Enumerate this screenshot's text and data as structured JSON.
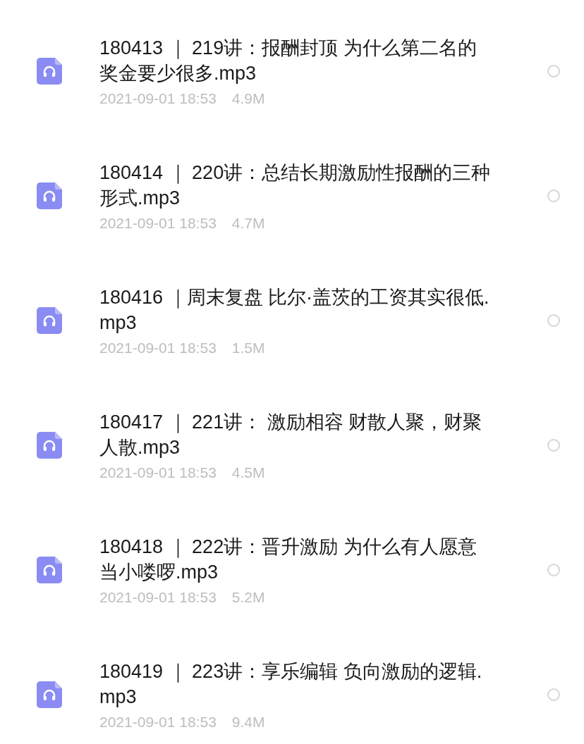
{
  "files": [
    {
      "name": "180413 ｜ 219讲：报酬封顶  为什么第二名的奖金要少很多.mp3",
      "date": "2021-09-01 18:53",
      "size": "4.9M",
      "selected": false
    },
    {
      "name": "180414 ｜ 220讲：总结长期激励性报酬的三种形式.mp3",
      "date": "2021-09-01 18:53",
      "size": "4.7M",
      "selected": false
    },
    {
      "name": "180416 ｜周末复盘  比尔·盖茨的工资其实很低.mp3",
      "date": "2021-09-01 18:53",
      "size": "1.5M",
      "selected": false
    },
    {
      "name": "180417 ｜ 221讲：  激励相容  财散人聚，财聚人散.mp3",
      "date": "2021-09-01 18:53",
      "size": "4.5M",
      "selected": false
    },
    {
      "name": "180418 ｜ 222讲：晋升激励  为什么有人愿意当小喽啰.mp3",
      "date": "2021-09-01 18:53",
      "size": "5.2M",
      "selected": false
    },
    {
      "name": "180419 ｜ 223讲：享乐编辑  负向激励的逻辑.mp3",
      "date": "2021-09-01 18:53",
      "size": "9.4M",
      "selected": false
    }
  ]
}
